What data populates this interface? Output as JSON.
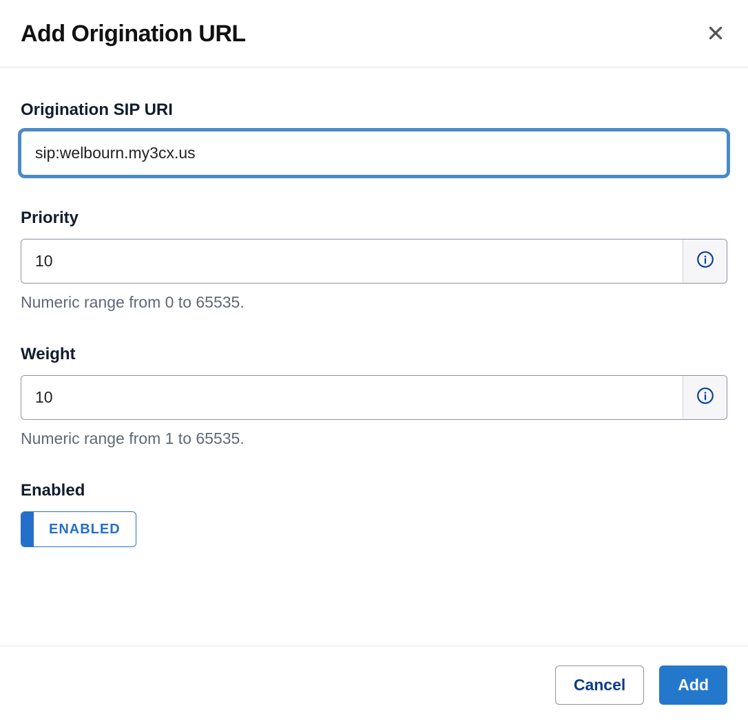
{
  "modal": {
    "title": "Add Origination URL"
  },
  "fields": {
    "sip_uri": {
      "label": "Origination SIP URI",
      "value": "sip:welbourn.my3cx.us"
    },
    "priority": {
      "label": "Priority",
      "value": "10",
      "help": "Numeric range from 0 to 65535."
    },
    "weight": {
      "label": "Weight",
      "value": "10",
      "help": "Numeric range from 1 to 65535."
    },
    "enabled": {
      "label": "Enabled",
      "toggle_text": "ENABLED"
    }
  },
  "footer": {
    "cancel": "Cancel",
    "add": "Add"
  }
}
